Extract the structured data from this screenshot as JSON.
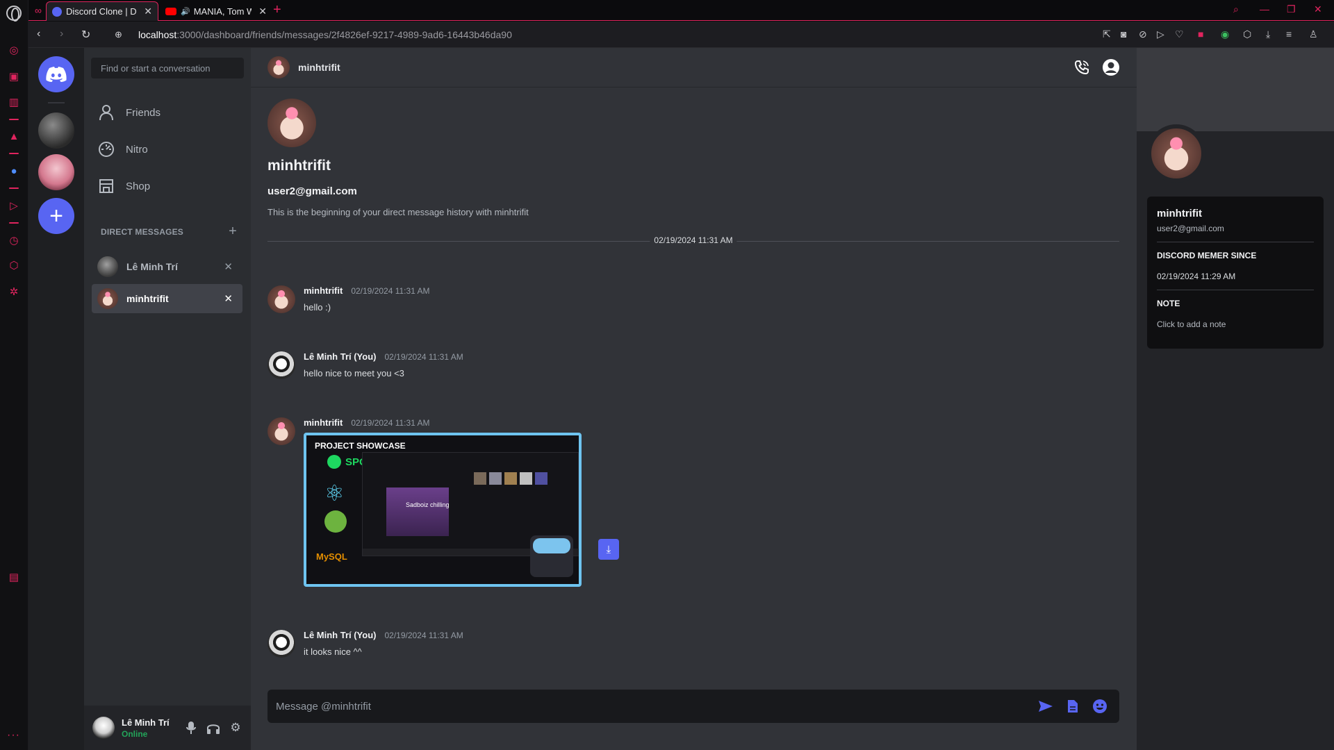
{
  "browser": {
    "tabs": [
      {
        "title": "Discord Clone | Direct Mes",
        "active": true
      },
      {
        "title": "MANIA, Tom Wigley &",
        "active": false
      }
    ],
    "url_host": "localhost",
    "url_path": ":3000/dashboard/friends/messages/2f4826ef-9217-4989-9ad6-16443b46da90"
  },
  "sidebar": {
    "search_placeholder": "Find or start a conversation",
    "nav": [
      {
        "label": "Friends",
        "icon": "person-icon"
      },
      {
        "label": "Nitro",
        "icon": "nitro-icon"
      },
      {
        "label": "Shop",
        "icon": "shop-icon"
      }
    ],
    "dm_header": "DIRECT MESSAGES",
    "dms": [
      {
        "name": "Lê Minh Trí",
        "active": false
      },
      {
        "name": "minhtrifit",
        "active": true
      }
    ],
    "user": {
      "name": "Lê Minh Trí",
      "status": "Online"
    }
  },
  "chat": {
    "header_title": "minhtrifit",
    "intro": {
      "name": "minhtrifit",
      "email": "user2@gmail.com",
      "description": "This is the beginning of your direct message history with minhtrifit"
    },
    "divider_date": "02/19/2024 11:31 AM",
    "messages": [
      {
        "author": "minhtrifit",
        "time": "02/19/2024 11:31 AM",
        "text": "hello :)"
      },
      {
        "author": "Lê Minh Trí (You)",
        "time": "02/19/2024 11:31 AM",
        "text": "hello nice to meet you <3"
      },
      {
        "author": "minhtrifit",
        "time": "02/19/2024 11:31 AM",
        "text": ""
      },
      {
        "author": "Lê Minh Trí (You)",
        "time": "02/19/2024 11:31 AM",
        "text": "it looks nice ^^"
      }
    ],
    "attachment": {
      "heading": "PROJECT SHOWCASE",
      "brand": "SPOTIFY CLONE",
      "caption": "Sadboiz chilling",
      "db_label": "MySQL"
    },
    "composer_placeholder": "Message @minhtrifit"
  },
  "profile": {
    "name": "minhtrifit",
    "email": "user2@gmail.com",
    "member_since_label": "DISCORD MEMER SINCE",
    "member_since": "02/19/2024 11:29 AM",
    "note_label": "NOTE",
    "note_placeholder": "Click to add a note"
  },
  "colors": {
    "accent": "#5865f2",
    "opera": "#e0245e",
    "online": "#23a55a"
  }
}
